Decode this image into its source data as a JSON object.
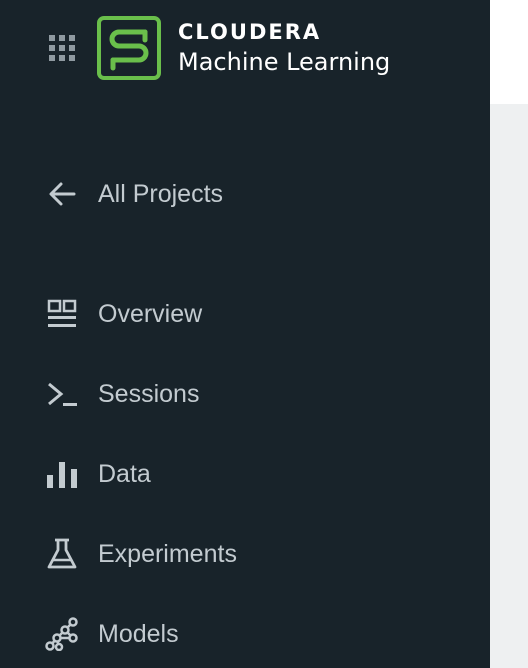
{
  "brand": {
    "name": "CLOUDERA",
    "product": "Machine Learning"
  },
  "colors": {
    "sidebar_bg": "#18232a",
    "nav_text": "#c3cbd0",
    "logo_green": "#6abf4b",
    "main_bg": "#eef0f1"
  },
  "nav": {
    "back": {
      "label": "All Projects",
      "icon": "arrow-left-icon"
    },
    "items": [
      {
        "label": "Overview",
        "icon": "overview-icon"
      },
      {
        "label": "Sessions",
        "icon": "terminal-icon"
      },
      {
        "label": "Data",
        "icon": "bar-chart-icon"
      },
      {
        "label": "Experiments",
        "icon": "flask-icon"
      },
      {
        "label": "Models",
        "icon": "network-nodes-icon"
      }
    ]
  }
}
